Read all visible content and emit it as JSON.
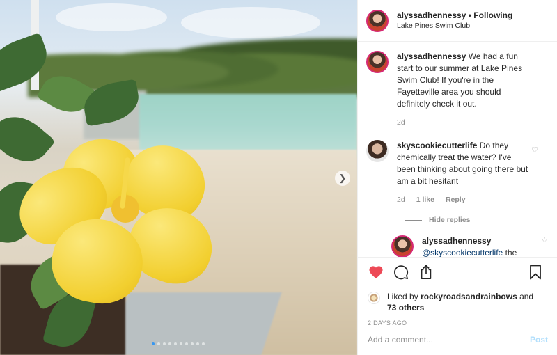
{
  "post": {
    "username": "alyssadhennessy",
    "follow_status": "Following",
    "separator": "•",
    "location": "Lake Pines Swim Club",
    "carousel": {
      "count": 10,
      "active_index": 0
    },
    "caption": {
      "username": "alyssadhennessy",
      "text": "We had a fun start to our summer at Lake Pines Swim Club! If you're in the Fayetteville area you should definitely check it out.",
      "time": "2d"
    },
    "comments": [
      {
        "username": "skyscookiecutterlife",
        "text": "Do they chemically treat the water? I've been thinking about going there but am a bit hesitant",
        "time": "2d",
        "likes": "1 like",
        "reply_label": "Reply",
        "hide_replies_label": "Hide replies"
      }
    ],
    "reply": {
      "username": "alyssadhennessy",
      "mention": "@skyscookiecutterlife",
      "text": " the lake has a filtration system"
    },
    "actions": {
      "liked": true,
      "like_color": "#ed4956"
    },
    "likes": {
      "prefix": "Liked by ",
      "liker": "rockyroadsandrainbows",
      "suffix": " and",
      "others": "73 others"
    },
    "date": "2 DAYS AGO",
    "add_comment": {
      "placeholder": "Add a comment...",
      "post_label": "Post"
    }
  }
}
